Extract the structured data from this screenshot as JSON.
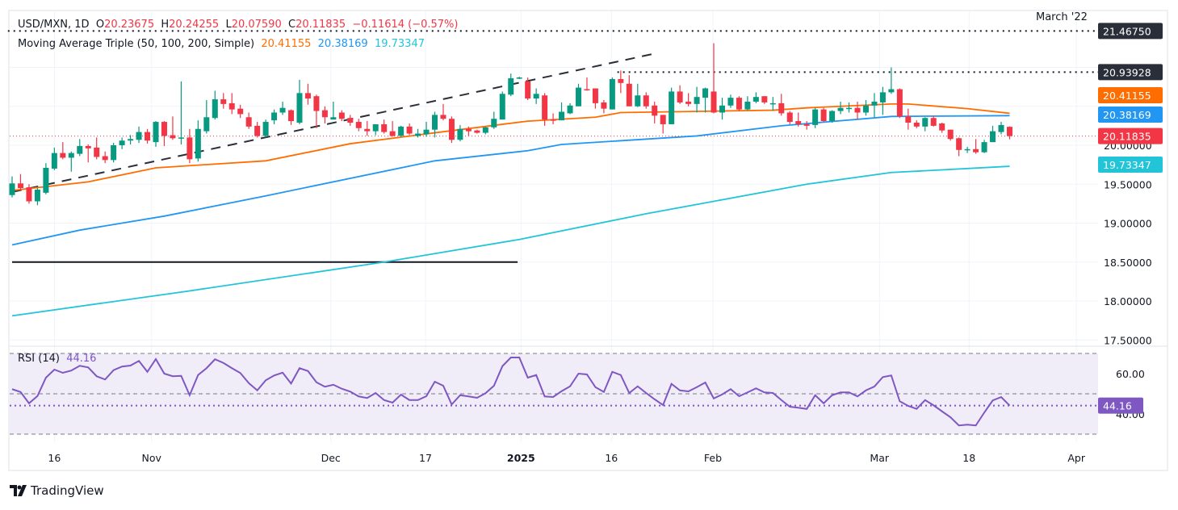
{
  "header": {
    "symbol": "USD/MXN",
    "interval": "1D",
    "open_label": "O",
    "open": "20.23675",
    "high_label": "H",
    "high": "20.24255",
    "low_label": "L",
    "low": "20.07590",
    "close_label": "C",
    "close": "20.11835",
    "change": "−0.11614 (−0.57%)"
  },
  "ma_legend": {
    "name": "Moving Average Triple (50, 100, 200, Simple)",
    "ma50": "20.41155",
    "ma100": "20.38169",
    "ma200": "19.73347"
  },
  "rsi_legend": {
    "name": "RSI (14)",
    "value": "44.16"
  },
  "annotation": {
    "label": "March '22"
  },
  "footer": {
    "brand": "TradingView"
  },
  "colors": {
    "up": "#089981",
    "down": "#f23645",
    "ma50": "#ff6d00",
    "ma100": "#2196f3",
    "ma200": "#22c5d8",
    "rsi": "#7e57c2",
    "rsi_band": "#f0ecf8",
    "level_tag": "#2a2e39"
  },
  "chart_data": [
    {
      "type": "candlestick",
      "title": "USD/MXN, 1D",
      "ylim": [
        17.4,
        21.55
      ],
      "y_ticks": [
        "17.50000",
        "18.00000",
        "18.50000",
        "19.00000",
        "19.50000",
        "20.00000"
      ],
      "x_ticks": [
        {
          "label": "16",
          "bar": 5,
          "bold": false
        },
        {
          "label": "Nov",
          "bar": 16.5,
          "bold": false
        },
        {
          "label": "Dec",
          "bar": 37.7,
          "bold": false
        },
        {
          "label": "17",
          "bar": 48.9,
          "bold": false
        },
        {
          "label": "2025",
          "bar": 60.2,
          "bold": true
        },
        {
          "label": "16",
          "bar": 70.9,
          "bold": false
        },
        {
          "label": "Feb",
          "bar": 82.9,
          "bold": false
        },
        {
          "label": "Mar",
          "bar": 102.6,
          "bold": false
        },
        {
          "label": "18",
          "bar": 113.2,
          "bold": false
        },
        {
          "label": "Apr",
          "bar": 125.9,
          "bold": false
        }
      ],
      "ohlc": [
        [
          19.36,
          19.6,
          19.33,
          19.51
        ],
        [
          19.51,
          19.63,
          19.42,
          19.45
        ],
        [
          19.46,
          19.5,
          19.25,
          19.28
        ],
        [
          19.28,
          19.45,
          19.23,
          19.43
        ],
        [
          19.39,
          19.77,
          19.37,
          19.71
        ],
        [
          19.7,
          19.97,
          19.68,
          19.9
        ],
        [
          19.9,
          20.04,
          19.82,
          19.84
        ],
        [
          19.84,
          19.92,
          19.66,
          19.9
        ],
        [
          19.89,
          20.08,
          19.86,
          19.99
        ],
        [
          19.99,
          20.01,
          19.78,
          19.96
        ],
        [
          19.97,
          20.1,
          19.82,
          19.85
        ],
        [
          19.86,
          19.92,
          19.77,
          19.81
        ],
        [
          19.81,
          20.03,
          19.78,
          20.0
        ],
        [
          20.0,
          20.1,
          19.95,
          20.06
        ],
        [
          20.06,
          20.13,
          20.01,
          20.08
        ],
        [
          20.07,
          20.24,
          20.03,
          20.17
        ],
        [
          20.17,
          20.21,
          20.02,
          20.06
        ],
        [
          20.04,
          20.31,
          19.98,
          20.3
        ],
        [
          20.3,
          20.31,
          19.99,
          20.12
        ],
        [
          20.13,
          20.37,
          20.07,
          20.09
        ],
        [
          20.09,
          20.82,
          20.01,
          20.1
        ],
        [
          20.1,
          20.21,
          19.77,
          19.82
        ],
        [
          19.83,
          20.32,
          19.79,
          20.21
        ],
        [
          20.18,
          20.58,
          20.15,
          20.36
        ],
        [
          20.35,
          20.7,
          20.33,
          20.59
        ],
        [
          20.59,
          20.67,
          20.47,
          20.53
        ],
        [
          20.54,
          20.67,
          20.4,
          20.46
        ],
        [
          20.47,
          20.52,
          20.35,
          20.4
        ],
        [
          20.36,
          20.42,
          20.21,
          20.24
        ],
        [
          20.25,
          20.3,
          20.1,
          20.12
        ],
        [
          20.12,
          20.33,
          20.1,
          20.3
        ],
        [
          20.32,
          20.46,
          20.27,
          20.42
        ],
        [
          20.42,
          20.56,
          20.39,
          20.48
        ],
        [
          20.45,
          20.46,
          20.26,
          20.31
        ],
        [
          20.29,
          20.84,
          20.27,
          20.67
        ],
        [
          20.67,
          20.79,
          20.52,
          20.6
        ],
        [
          20.63,
          20.65,
          20.22,
          20.44
        ],
        [
          20.45,
          20.5,
          20.28,
          20.36
        ],
        [
          20.33,
          20.56,
          20.33,
          20.36
        ],
        [
          20.42,
          20.45,
          20.31,
          20.34
        ],
        [
          20.35,
          20.39,
          20.25,
          20.29
        ],
        [
          20.3,
          20.34,
          20.18,
          20.22
        ],
        [
          20.21,
          20.31,
          20.12,
          20.18
        ],
        [
          20.18,
          20.27,
          20.13,
          20.27
        ],
        [
          20.27,
          20.33,
          20.15,
          20.17
        ],
        [
          20.18,
          20.31,
          20.11,
          20.12
        ],
        [
          20.12,
          20.25,
          20.11,
          20.24
        ],
        [
          20.24,
          20.28,
          20.13,
          20.15
        ],
        [
          20.12,
          20.21,
          20.1,
          20.15
        ],
        [
          20.14,
          20.3,
          20.11,
          20.2
        ],
        [
          20.2,
          20.43,
          20.1,
          20.39
        ],
        [
          20.39,
          20.53,
          20.32,
          20.34
        ],
        [
          20.34,
          20.37,
          20.03,
          20.07
        ],
        [
          20.07,
          20.26,
          20.05,
          20.21
        ],
        [
          20.21,
          20.24,
          20.12,
          20.18
        ],
        [
          20.19,
          20.2,
          20.15,
          20.16
        ],
        [
          20.16,
          20.24,
          20.14,
          20.23
        ],
        [
          20.23,
          20.43,
          20.21,
          20.34
        ],
        [
          20.33,
          20.69,
          20.33,
          20.66
        ],
        [
          20.65,
          20.92,
          20.63,
          20.86
        ],
        [
          20.86,
          20.88,
          20.85,
          20.87
        ],
        [
          20.82,
          20.87,
          20.58,
          20.6
        ],
        [
          20.6,
          20.73,
          20.53,
          20.66
        ],
        [
          20.64,
          20.67,
          20.25,
          20.33
        ],
        [
          20.33,
          20.41,
          20.27,
          20.32
        ],
        [
          20.32,
          20.55,
          20.32,
          20.43
        ],
        [
          20.41,
          20.54,
          20.4,
          20.51
        ],
        [
          20.5,
          20.79,
          20.5,
          20.74
        ],
        [
          20.72,
          20.87,
          20.7,
          20.71
        ],
        [
          20.73,
          20.73,
          20.47,
          20.54
        ],
        [
          20.55,
          20.58,
          20.41,
          20.47
        ],
        [
          20.46,
          20.87,
          20.46,
          20.85
        ],
        [
          20.85,
          20.96,
          20.67,
          20.8
        ],
        [
          20.79,
          20.9,
          20.5,
          20.5
        ],
        [
          20.5,
          20.79,
          20.49,
          20.64
        ],
        [
          20.64,
          20.68,
          20.47,
          20.5
        ],
        [
          20.51,
          20.56,
          20.28,
          20.38
        ],
        [
          20.39,
          20.39,
          20.15,
          20.27
        ],
        [
          20.27,
          20.74,
          20.27,
          20.69
        ],
        [
          20.69,
          20.77,
          20.53,
          20.55
        ],
        [
          20.56,
          20.67,
          20.5,
          20.53
        ],
        [
          20.53,
          20.75,
          20.42,
          20.62
        ],
        [
          20.61,
          20.74,
          20.42,
          20.73
        ],
        [
          20.69,
          21.31,
          20.41,
          20.42
        ],
        [
          20.42,
          20.61,
          20.33,
          20.51
        ],
        [
          20.51,
          20.65,
          20.48,
          20.61
        ],
        [
          20.61,
          20.63,
          20.44,
          20.46
        ],
        [
          20.46,
          20.63,
          20.45,
          20.56
        ],
        [
          20.56,
          20.68,
          20.54,
          20.62
        ],
        [
          20.63,
          20.63,
          20.53,
          20.55
        ],
        [
          20.54,
          20.62,
          20.44,
          20.54
        ],
        [
          20.54,
          20.66,
          20.38,
          20.41
        ],
        [
          20.42,
          20.44,
          20.27,
          20.3
        ],
        [
          20.31,
          20.42,
          20.24,
          20.27
        ],
        [
          20.27,
          20.31,
          20.2,
          20.25
        ],
        [
          20.26,
          20.48,
          20.22,
          20.46
        ],
        [
          20.46,
          20.48,
          20.3,
          20.31
        ],
        [
          20.31,
          20.45,
          20.29,
          20.44
        ],
        [
          20.44,
          20.56,
          20.4,
          20.48
        ],
        [
          20.48,
          20.55,
          20.42,
          20.48
        ],
        [
          20.48,
          20.56,
          20.33,
          20.42
        ],
        [
          20.42,
          20.58,
          20.38,
          20.51
        ],
        [
          20.51,
          20.67,
          20.36,
          20.56
        ],
        [
          20.55,
          20.75,
          20.39,
          20.68
        ],
        [
          20.68,
          21.0,
          20.66,
          20.72
        ],
        [
          20.72,
          20.73,
          20.35,
          20.37
        ],
        [
          20.37,
          20.47,
          20.2,
          20.29
        ],
        [
          20.29,
          20.32,
          20.22,
          20.24
        ],
        [
          20.24,
          20.36,
          20.18,
          20.35
        ],
        [
          20.35,
          20.38,
          20.24,
          20.25
        ],
        [
          20.28,
          20.29,
          20.16,
          20.19
        ],
        [
          20.2,
          20.2,
          20.06,
          20.08
        ],
        [
          20.09,
          20.1,
          19.86,
          19.94
        ],
        [
          19.95,
          19.98,
          19.9,
          19.95
        ],
        [
          19.95,
          20.08,
          19.89,
          19.91
        ],
        [
          19.91,
          20.07,
          19.9,
          20.04
        ],
        [
          20.04,
          20.25,
          20.04,
          20.18
        ],
        [
          20.17,
          20.3,
          20.14,
          20.26
        ],
        [
          20.23675,
          20.24255,
          20.0759,
          20.11835
        ]
      ],
      "moving_averages": [
        {
          "name": "MA 50",
          "last": "20.41155",
          "points": [
            [
              0,
              19.42
            ],
            [
              9,
              19.53
            ],
            [
              17,
              19.71
            ],
            [
              30,
              19.8
            ],
            [
              40,
              20.02
            ],
            [
              50,
              20.16
            ],
            [
              61,
              20.31
            ],
            [
              69,
              20.36
            ],
            [
              72,
              20.42
            ],
            [
              90,
              20.45
            ],
            [
              94,
              20.48
            ],
            [
              104,
              20.53
            ],
            [
              106,
              20.53
            ],
            [
              113,
              20.47
            ],
            [
              118,
              20.41
            ]
          ]
        },
        {
          "name": "MA 100",
          "last": "20.38169",
          "points": [
            [
              0,
              18.72
            ],
            [
              8,
              18.91
            ],
            [
              18,
              19.09
            ],
            [
              30,
              19.35
            ],
            [
              50,
              19.8
            ],
            [
              61,
              19.93
            ],
            [
              65,
              20.01
            ],
            [
              81,
              20.12
            ],
            [
              91,
              20.25
            ],
            [
              104,
              20.37
            ],
            [
              118,
              20.38
            ]
          ]
        },
        {
          "name": "MA 200",
          "last": "19.73347",
          "points": [
            [
              0,
              17.81
            ],
            [
              21,
              18.13
            ],
            [
              44,
              18.5
            ],
            [
              60,
              18.79
            ],
            [
              75,
              19.12
            ],
            [
              94,
              19.5
            ],
            [
              104,
              19.65
            ],
            [
              118,
              19.73
            ]
          ]
        }
      ],
      "drawings": {
        "trendline": [
          [
            0,
            19.4
          ],
          [
            75.7,
            21.17
          ]
        ],
        "horizontal_line": {
          "value": 18.5,
          "from_bar": 0,
          "to_bar": 59.8
        },
        "dotted_levels": [
          {
            "value": 21.4675,
            "label": "21.46750",
            "from_bar": -0.5
          },
          {
            "value": 20.93928,
            "label": "20.93928",
            "from_bar": 71.6
          }
        ],
        "last_price": {
          "value": 20.11835,
          "label": "20.11835"
        }
      }
    },
    {
      "type": "line",
      "title": "RSI (14)",
      "ylim": [
        30,
        70
      ],
      "bands": [
        30,
        50,
        70
      ],
      "y_ticks": [
        "60.00",
        "40.00"
      ],
      "last": "44.16",
      "values": [
        52.3,
        50.9,
        45.3,
        48.9,
        58.0,
        62.0,
        60.4,
        61.5,
        63.9,
        63.1,
        58.7,
        57.1,
        61.7,
        63.5,
        64.0,
        66.3,
        60.9,
        67.2,
        60.0,
        58.7,
        58.9,
        49.3,
        59.3,
        62.7,
        67.1,
        65.3,
        62.7,
        60.3,
        55.3,
        51.7,
        56.7,
        59.1,
        60.5,
        55.1,
        62.7,
        61.3,
        55.7,
        53.5,
        54.5,
        52.5,
        51.1,
        48.7,
        47.9,
        50.4,
        46.9,
        45.6,
        49.6,
        46.9,
        46.9,
        48.8,
        56.0,
        54.0,
        44.7,
        49.3,
        48.7,
        48.0,
        50.3,
        54.0,
        63.7,
        68.0,
        68.0,
        58.0,
        59.3,
        48.7,
        48.4,
        51.3,
        53.7,
        60.0,
        59.6,
        53.3,
        50.9,
        60.9,
        59.3,
        50.4,
        53.7,
        50.4,
        47.3,
        44.4,
        54.9,
        51.7,
        51.2,
        53.3,
        55.6,
        47.7,
        49.7,
        52.3,
        48.8,
        50.7,
        52.7,
        50.7,
        50.4,
        46.9,
        43.6,
        43.1,
        42.5,
        49.3,
        45.3,
        49.3,
        50.7,
        50.7,
        48.7,
        51.7,
        53.6,
        58.3,
        59.1,
        46.3,
        44.0,
        42.5,
        46.9,
        44.3,
        41.3,
        38.4,
        34.3,
        34.7,
        34.3,
        40.7,
        46.7,
        48.4,
        44.16
      ]
    }
  ]
}
